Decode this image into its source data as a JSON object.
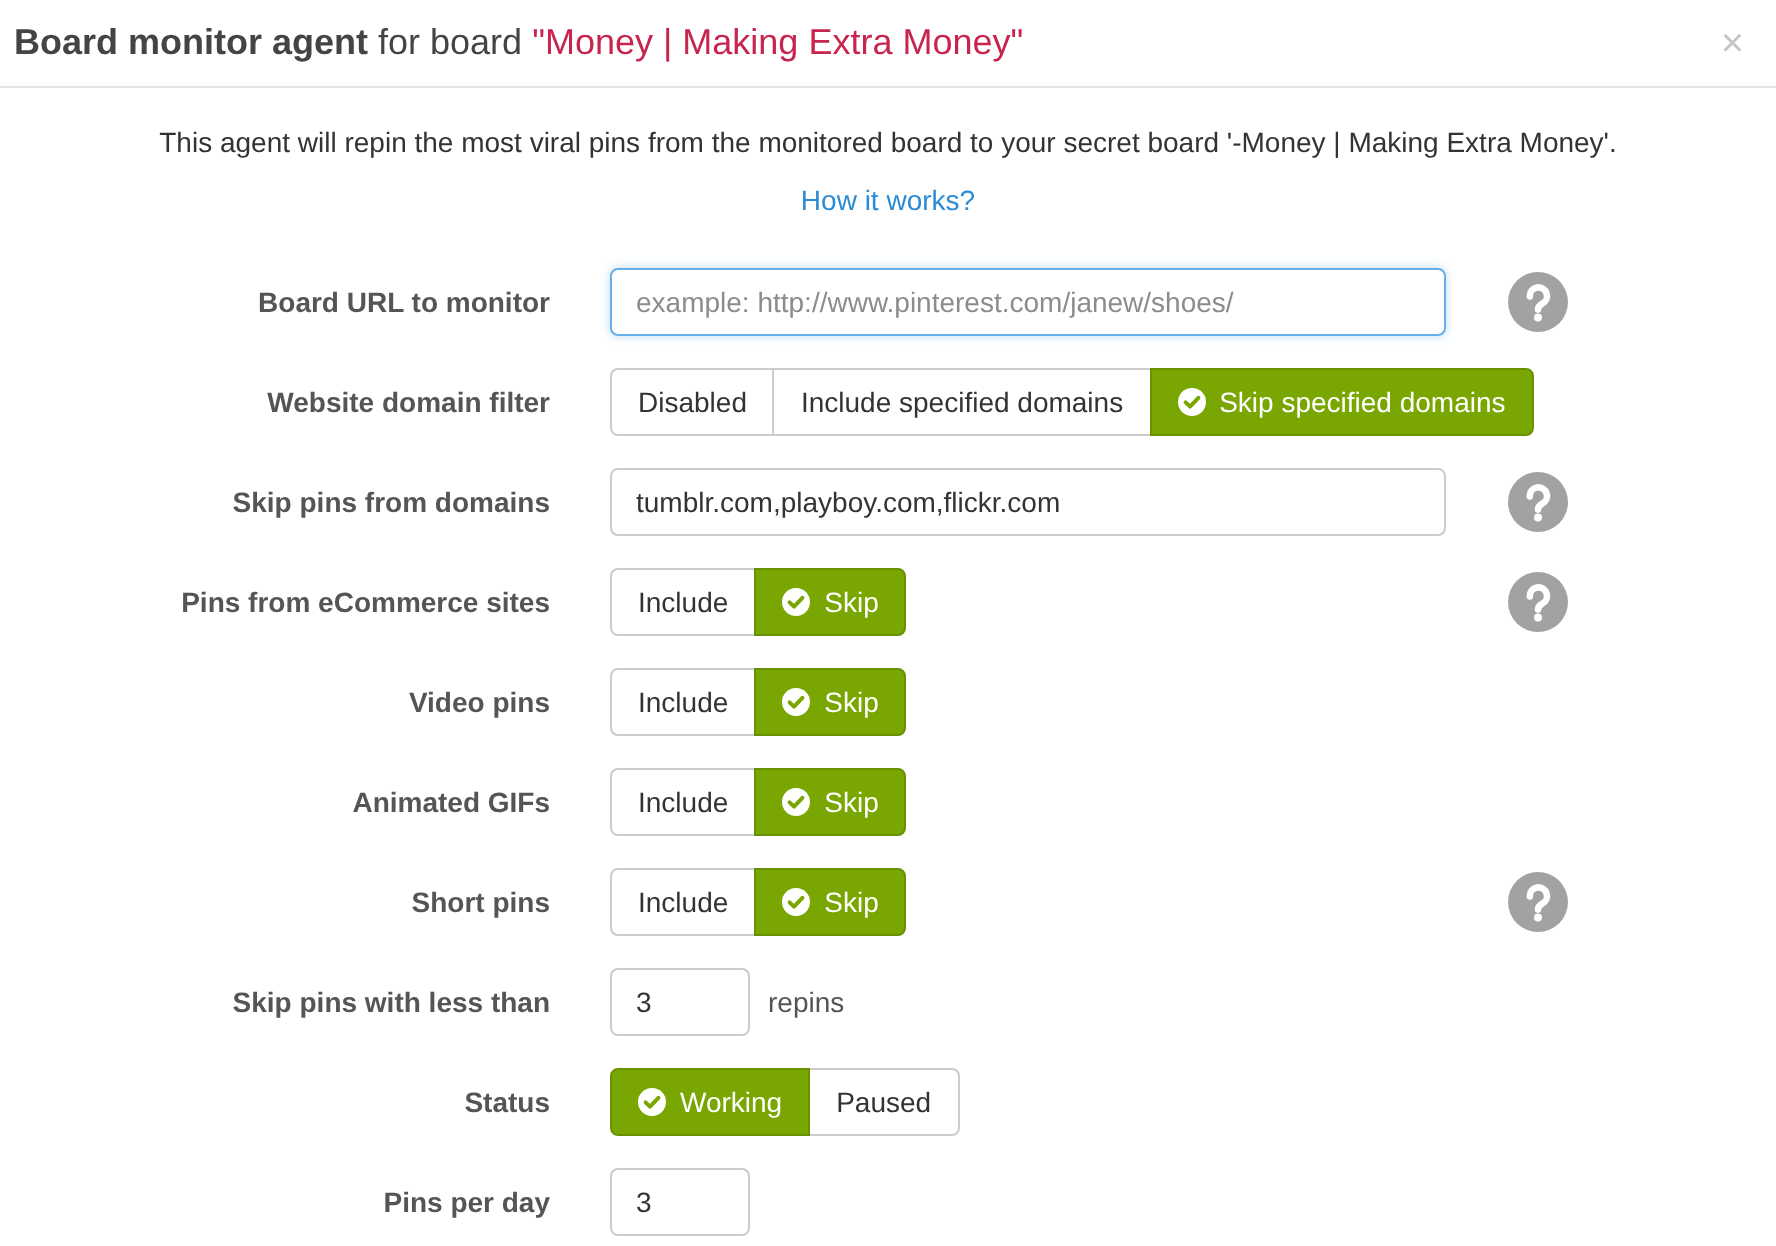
{
  "header": {
    "title": "**Board monitor agent** for board",
    "board_name": "\"Money | Making Extra Money\"",
    "close": "×"
  },
  "intro": "This agent will repin the most viral pins from the monitored board to your secret board '-Money | Making Extra Money'.",
  "help_link": "How it works?",
  "fields": [
    {
      "kind": "text",
      "label": "Board URL to monitor",
      "placeholder": "example: http://www.pinterest.com/janew/shoes/",
      "focused": true,
      "help": true
    },
    {
      "kind": "choice",
      "label": "Website domain filter",
      "options": [
        {
          "label": "Disabled",
          "selected": false
        },
        {
          "label": "Include specified domains",
          "selected": false
        },
        {
          "label": "Skip specified domains",
          "selected": true
        }
      ],
      "help": false
    },
    {
      "kind": "text",
      "label": "Skip pins from domains",
      "value": "tumblr.com,playboy.com,flickr.com",
      "focused": false,
      "help": true
    },
    {
      "kind": "choice",
      "label": "Pins from eCommerce sites",
      "options": [
        {
          "label": "Include",
          "selected": false
        },
        {
          "label": "Skip",
          "selected": true
        }
      ],
      "help": true
    },
    {
      "kind": "choice",
      "label": "Video pins",
      "options": [
        {
          "label": "Include",
          "selected": false
        },
        {
          "label": "Skip",
          "selected": true
        }
      ],
      "help": false
    },
    {
      "kind": "choice",
      "label": "Animated GIFs",
      "options": [
        {
          "label": "Include",
          "selected": false
        },
        {
          "label": "Skip",
          "selected": true
        }
      ],
      "help": false
    },
    {
      "kind": "choice",
      "label": "Short pins",
      "options": [
        {
          "label": "Include",
          "selected": false
        },
        {
          "label": "Skip",
          "selected": true
        }
      ],
      "help": true
    },
    {
      "kind": "number",
      "label": "Skip pins with less than",
      "value": "3",
      "suffix": "repins",
      "focused": false,
      "help": false
    },
    {
      "kind": "choice",
      "label": "Status",
      "options": [
        {
          "label": "Working",
          "selected": true
        },
        {
          "label": "Paused",
          "selected": false
        }
      ],
      "help": false
    },
    {
      "kind": "number",
      "label": "Pins per day",
      "value": "3",
      "focused": false,
      "help": false
    }
  ]
}
